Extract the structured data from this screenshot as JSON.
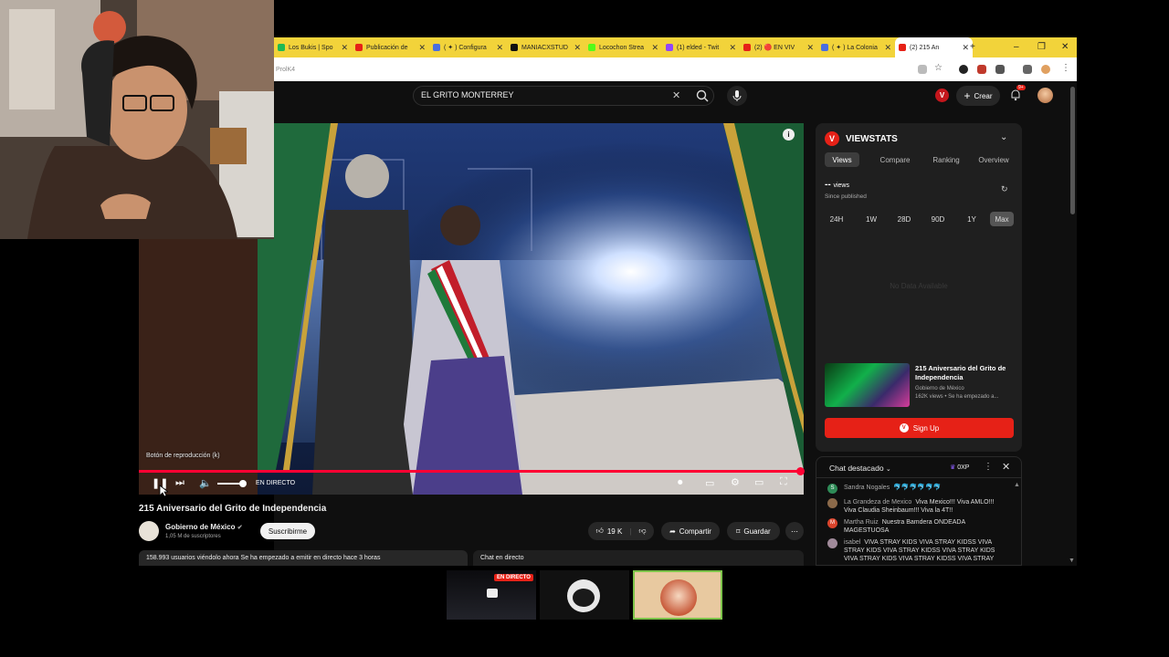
{
  "browser": {
    "tabs": [
      {
        "label": "Los Bukis | Spo",
        "color": "#1db954"
      },
      {
        "label": "Publicación de",
        "color": "#e62117"
      },
      {
        "label": "( ✦ ) Configura",
        "color": "#4a6ee0"
      },
      {
        "label": "MANIACXSTUD",
        "color": "#111111"
      },
      {
        "label": "Locochon Strea",
        "color": "#53fc18"
      },
      {
        "label": "(1) elded - Twit",
        "color": "#9146ff"
      },
      {
        "label": "(2) 🔴 EN VIV",
        "color": "#e62117"
      },
      {
        "label": "( ✦ ) La Colonia",
        "color": "#4a6ee0"
      },
      {
        "label": "(2) 215 An",
        "color": "#e62117",
        "active": true
      }
    ],
    "new_tab": "+",
    "url_fragment": "ProlK4"
  },
  "header": {
    "search_value": "EL GRITO MONTERREY",
    "create_label": "Crear",
    "notif_count": "9+"
  },
  "player": {
    "tooltip": "Botón de reproducción (k)",
    "live_label": "EN DIRECTO",
    "progress": 0.995
  },
  "video": {
    "title": "215 Aniversario del Grito de Independencia",
    "channel": "Gobierno de México",
    "subscribers": "1,05 M de suscriptores",
    "subscribe_label": "Suscribirme",
    "likes": "19 K",
    "share_label": "Compartir",
    "save_label": "Guardar",
    "watching_text": "158.993 usuarios viéndolo ahora  Se ha empezado a emitir en directo hace 3 horas",
    "live_chat_label": "Chat en directo"
  },
  "viewstats": {
    "logo_letter": "V",
    "title": "VIEWSTATS",
    "tabs": [
      "Views",
      "Compare",
      "Ranking",
      "Overview"
    ],
    "active_tab": "Views",
    "value": "--",
    "value_unit": "views",
    "since": "Since published",
    "ranges": [
      "24H",
      "1W",
      "28D",
      "90D",
      "1Y",
      "Max"
    ],
    "active_range": "Max",
    "no_data": "No Data Available",
    "card_title": "215 Aniversario del Grito de Independencia",
    "card_channel": "Gobierno de México",
    "card_meta": "162K views • Se ha empezado a...",
    "signup_label": "Sign Up"
  },
  "chat": {
    "title": "Chat destacado",
    "xp_label": "0XP",
    "messages": [
      {
        "name": "Sandra Nogales",
        "text": "🐬🐬🐬🐬🐬🐬",
        "avatar": "S",
        "color": "#2e8b57"
      },
      {
        "name": "La Grandeza de Mexico",
        "text": "Viva Mexico!!! Viva AMLO!!! Viva Claudia Sheinbaum!!! Viva la 4T!!",
        "avatar": "",
        "color": "#8b6a4a"
      },
      {
        "name": "Martha Ruiz",
        "text": "Nuestra Bamdera ONDEADA MAGESTUOSA",
        "avatar": "M",
        "color": "#d9442c"
      },
      {
        "name": "isabel",
        "text": "VIVA STRAY KIDS VIVA STRAY KIDSS VIVA STRAY KIDS VIVA STRAY KIDSS VIVA STRAY KIDS VIVA STRAY KIDS VIVA STRAY KIDSS VIVA STRAY",
        "avatar": "",
        "color": "#a08a9a"
      }
    ]
  },
  "bottom": {
    "live_badge": "EN DIRECTO"
  }
}
